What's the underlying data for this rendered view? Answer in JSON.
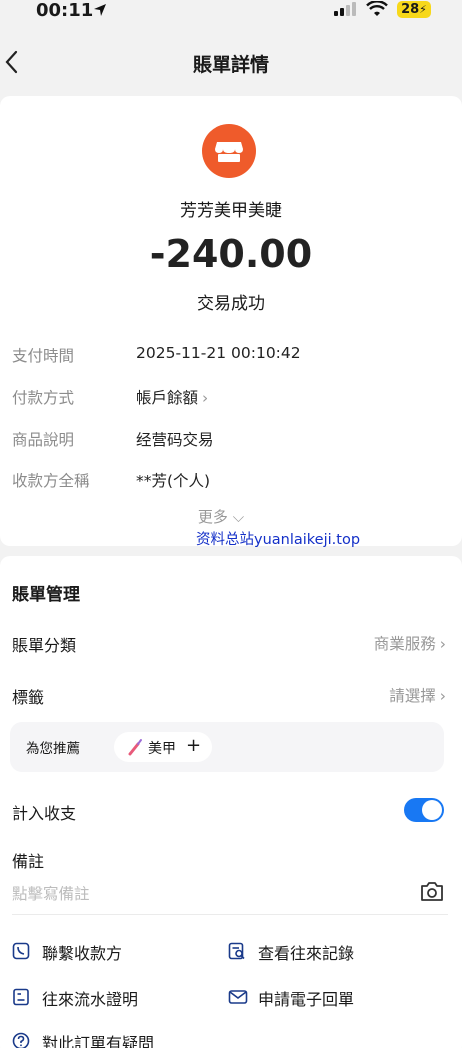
{
  "status_bar": {
    "time": "00:11",
    "battery": "28"
  },
  "nav": {
    "title": "賬單詳情"
  },
  "merchant": {
    "name": "芳芳美甲美睫",
    "amount": "-240.00",
    "status": "交易成功",
    "logo_color": "#ef5b2b"
  },
  "details": [
    {
      "label": "支付時間",
      "value": "2025-11-21 00:10:42"
    },
    {
      "label": "付款方式",
      "value": "帳戶餘額"
    },
    {
      "label": "商品說明",
      "value": "经营码交易"
    },
    {
      "label": "收款方全稱",
      "value": "**芳(个人)"
    }
  ],
  "more_label": "更多",
  "watermark": "资料总站yuanlaikeji.top",
  "management": {
    "title": "賬單管理",
    "category_label": "賬單分類",
    "category_value": "商業服務",
    "tag_label": "標籤",
    "tag_value": "請選擇",
    "recommend_label": "為您推薦",
    "recommend_chip": "美甲",
    "chip_plus": "+",
    "count_label": "計入收支",
    "count_enabled": true,
    "note_label": "備註",
    "note_placeholder": "點擊寫備註"
  },
  "actions": {
    "contact_payee": "聯繫收款方",
    "view_records": "查看往來記錄",
    "flow_proof": "往來流水證明",
    "e_receipt": "申請電子回單",
    "question": "對此訂單有疑問"
  },
  "colors": {
    "accent": "#1878f3",
    "brand_battery": "#f7d81a"
  }
}
